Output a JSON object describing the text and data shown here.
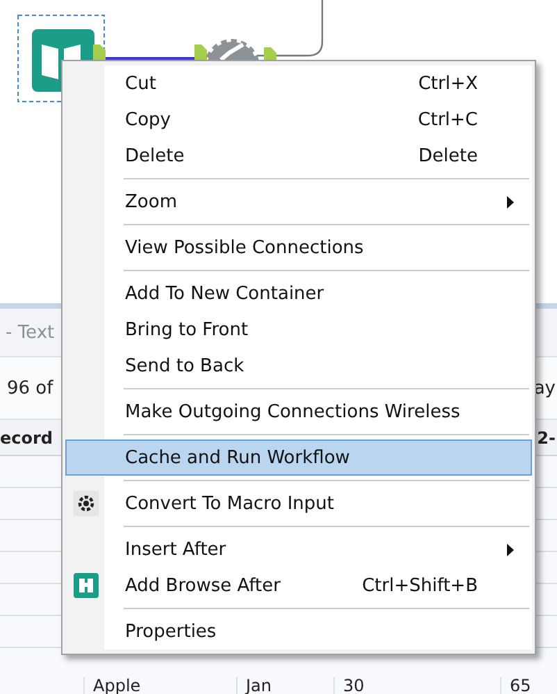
{
  "results_panel": {
    "title": "- Text",
    "record_count": "96 of",
    "display_label": "ay",
    "columns": [
      {
        "label": "ecord"
      },
      {
        "label": "2-"
      }
    ],
    "last_row": [
      "Apple",
      "Jan",
      "30",
      "65"
    ]
  },
  "context_menu": {
    "items": [
      {
        "kind": "item",
        "label": "Cut",
        "shortcut": "Ctrl+X",
        "selected": false
      },
      {
        "kind": "item",
        "label": "Copy",
        "shortcut": "Ctrl+C",
        "selected": false
      },
      {
        "kind": "item",
        "label": "Delete",
        "shortcut": "Delete",
        "selected": false
      },
      {
        "kind": "separator"
      },
      {
        "kind": "submenu",
        "label": "Zoom",
        "selected": false
      },
      {
        "kind": "separator"
      },
      {
        "kind": "item",
        "label": "View Possible Connections",
        "selected": false
      },
      {
        "kind": "separator"
      },
      {
        "kind": "item",
        "label": "Add To New Container",
        "selected": false
      },
      {
        "kind": "item",
        "label": "Bring to Front",
        "selected": false
      },
      {
        "kind": "item",
        "label": "Send to Back",
        "selected": false
      },
      {
        "kind": "separator"
      },
      {
        "kind": "item",
        "label": "Make Outgoing Connections Wireless",
        "selected": false
      },
      {
        "kind": "separator"
      },
      {
        "kind": "item",
        "label": "Cache and Run Workflow",
        "selected": true
      },
      {
        "kind": "separator"
      },
      {
        "kind": "macro",
        "label": "Convert To Macro Input",
        "selected": false
      },
      {
        "kind": "separator"
      },
      {
        "kind": "submenu",
        "label": "Insert After",
        "selected": false
      },
      {
        "kind": "browse",
        "label": "Add Browse After",
        "shortcut": "Ctrl+Shift+B",
        "selected": false
      },
      {
        "kind": "separator"
      },
      {
        "kind": "item",
        "label": "Properties",
        "selected": false
      }
    ]
  }
}
